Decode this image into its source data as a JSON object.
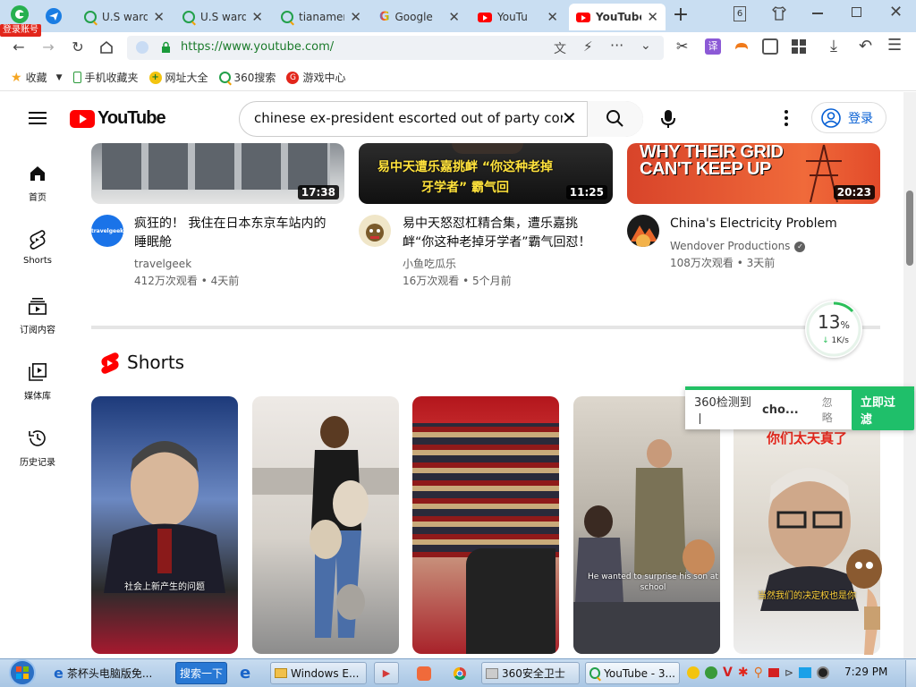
{
  "browser": {
    "login_badge": "登录账号",
    "tabs": [
      {
        "title": "U.S ward",
        "icon": "360-search-icon"
      },
      {
        "title": "U.S ward",
        "icon": "360-search-icon"
      },
      {
        "title": "tianamen",
        "icon": "360-search-icon"
      },
      {
        "title": "Google",
        "icon": "google-icon"
      },
      {
        "title": "YouTu",
        "icon": "youtube-icon"
      },
      {
        "title": "YouTube",
        "icon": "youtube-icon"
      }
    ],
    "new_tab": "+",
    "tab_count": "6",
    "url": "https://www.youtube.com/",
    "bookmarks": [
      {
        "label": "收藏"
      },
      {
        "label": "手机收藏夹"
      },
      {
        "label": "网址大全"
      },
      {
        "label": "360搜索"
      },
      {
        "label": "游戏中心"
      }
    ]
  },
  "youtube": {
    "logo_text": "YouTube",
    "search_value": "chinese ex-president escorted out of party congr",
    "signin": "登录",
    "sidebar": [
      {
        "label": "首页",
        "icon": "home-icon"
      },
      {
        "label": "Shorts",
        "icon": "shorts-icon"
      },
      {
        "label": "订阅内容",
        "icon": "subscriptions-icon"
      },
      {
        "label": "媒体库",
        "icon": "library-icon"
      },
      {
        "label": "历史记录",
        "icon": "history-icon"
      }
    ],
    "videos": [
      {
        "duration": "17:38",
        "title": "疯狂的！ 我住在日本东京车站内的睡眠舱",
        "channel": "travelgeek",
        "meta": "412万次观看 • 4天前",
        "avatar_text": "travelgeek",
        "thumb_text": ""
      },
      {
        "duration": "11:25",
        "title": "易中天怒怼杠精合集，遭乐嘉挑衅“你这种老掉牙学者”霸气回怼！",
        "channel": "小鱼吃瓜乐",
        "meta": "16万次观看 • 5个月前",
        "avatar_text": "",
        "thumb_text": "易中天遭乐嘉挑衅 “你这种老掉牙学者” 霸气回"
      },
      {
        "duration": "20:23",
        "title": "China's Electricity Problem",
        "channel": "Wendover Productions",
        "meta": "108万次观看 • 3天前",
        "avatar_text": "",
        "thumb_text": "WHY THEIR GRID CAN'T KEEP UP"
      }
    ],
    "shorts_heading": "Shorts",
    "shorts": [
      {
        "caption": "社会上新产生的问题"
      },
      {
        "caption": ""
      },
      {
        "caption": ""
      },
      {
        "caption": "He wanted to surprise his son at school"
      },
      {
        "caption": "当然我们的决定权也是你",
        "top_caption": "你们太天真了"
      }
    ]
  },
  "speed_widget": {
    "percent": "13",
    "unit": "%",
    "rate": "1K/s"
  },
  "notification": {
    "text": "360检测到丨",
    "query": "cho...",
    "ignore": "忽略",
    "action": "立即过滤"
  },
  "taskbar": {
    "items": [
      {
        "label": "茶杯头电脑版免..."
      },
      {
        "label": "搜索一下"
      },
      {
        "label": "Windows E..."
      },
      {
        "label": "360安全卫士"
      },
      {
        "label": "YouTube - 3..."
      }
    ],
    "clock": "7:29 PM"
  },
  "colors": {
    "yt_red": "#ff0000",
    "tabstrip": "#c9def2",
    "accent_green": "#1fbf6a",
    "taskbar": "#a9c6e4"
  }
}
